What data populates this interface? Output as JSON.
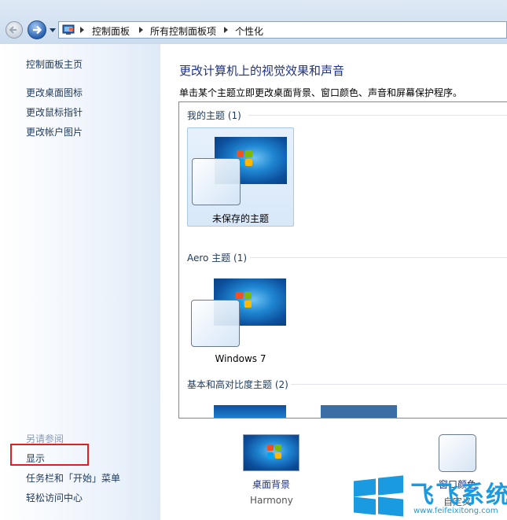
{
  "address_bar": {
    "crumbs": [
      "控制面板",
      "所有控制面板项",
      "个性化"
    ]
  },
  "left_pane": {
    "home": "控制面板主页",
    "links": [
      "更改桌面图标",
      "更改鼠标指针",
      "更改帐户图片"
    ],
    "see_also_title": "另请参阅",
    "see_also": [
      "显示",
      "任务栏和「开始」菜单",
      "轻松访问中心"
    ]
  },
  "main": {
    "title": "更改计算机上的视觉效果和声音",
    "description": "单击某个主题立即更改桌面背景、窗口颜色、声音和屏幕保护程序。",
    "groups": [
      {
        "title": "我的主题 (1)",
        "themes": [
          "未保存的主题"
        ]
      },
      {
        "title": "Aero 主题 (1)",
        "themes": [
          "Windows 7"
        ]
      },
      {
        "title": "基本和高对比度主题 (2)",
        "themes": []
      }
    ]
  },
  "bottom": {
    "desktop_bg_label": "桌面背景",
    "desktop_bg_value": "Harmony",
    "window_color_label": "窗口颜色",
    "window_color_value": "自定义"
  },
  "watermark": {
    "title": "飞飞系统",
    "url": "www.feifeixitong.com"
  },
  "colors": {
    "link": "#1e395b",
    "title": "#1e3287",
    "highlight_box": "#e02020",
    "watermark": "#1a9ae0"
  }
}
